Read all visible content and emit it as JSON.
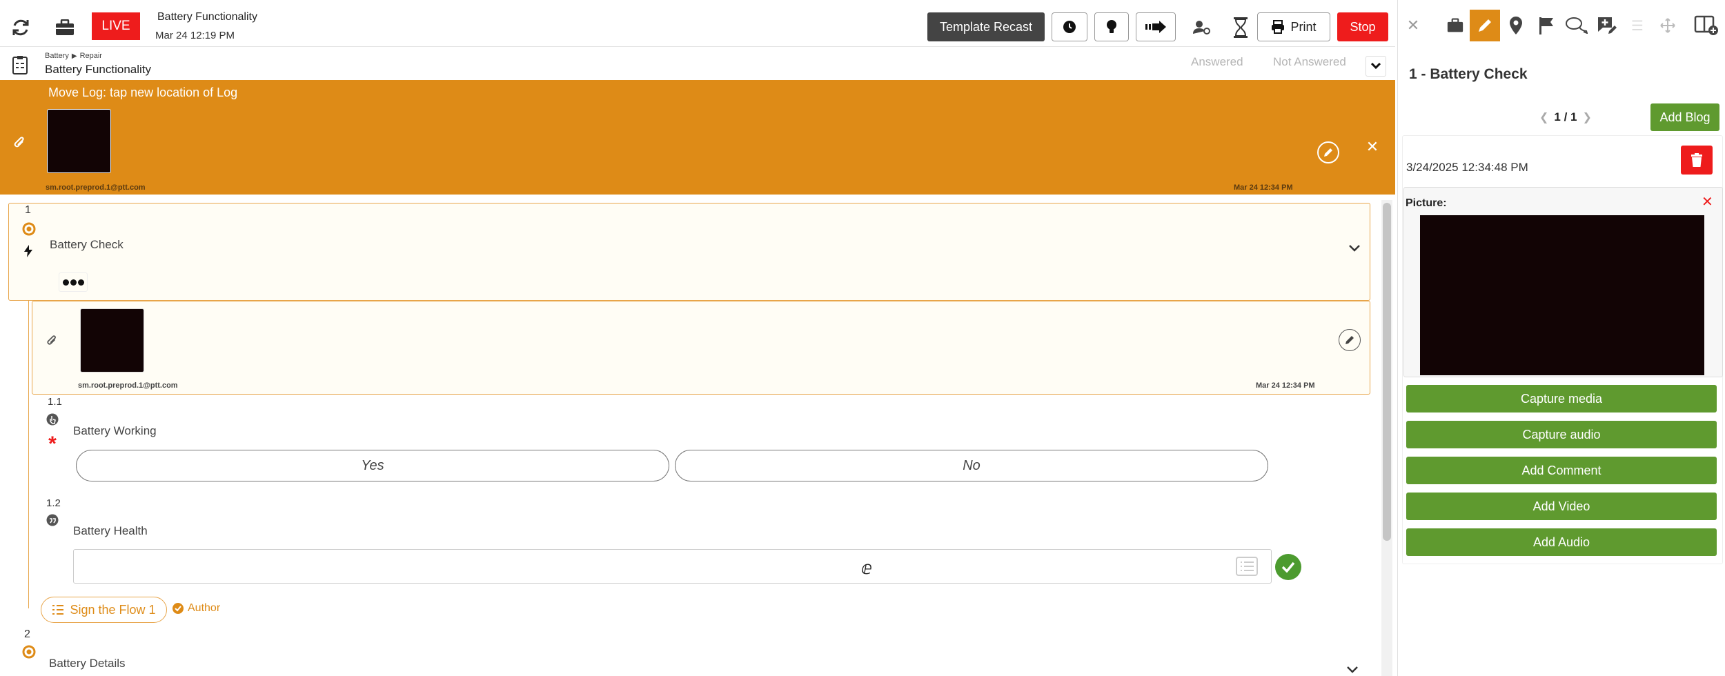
{
  "header": {
    "live_label": "LIVE",
    "title": "Battery Functionality",
    "date": "Mar 24 12:19 PM",
    "template_recast": "Template Recast",
    "print": "Print",
    "stop": "Stop"
  },
  "subheader": {
    "breadcrumb_parent": "Battery",
    "breadcrumb_child": "Repair",
    "title": "Battery Functionality",
    "tab_answered": "Answered",
    "tab_not_answered": "Not Answered"
  },
  "banner": {
    "message": "Move Log: tap new location of Log",
    "user": "sm.root.preprod.1@ptt.com",
    "timestamp": "Mar 24 12:34 PM"
  },
  "steps": {
    "step1_number": "1",
    "step1_title": "Battery Check",
    "attachment_user": "sm.root.preprod.1@ptt.com",
    "attachment_timestamp": "Mar 24 12:34 PM",
    "q11_number": "1.1",
    "q11_label": "Battery Working",
    "q11_yes": "Yes",
    "q11_no": "No",
    "q12_number": "1.2",
    "q12_label": "Battery Health",
    "sign_label": "Sign the Flow 1",
    "author_label": "Author",
    "step2_number": "2",
    "step2_title": "Battery Details"
  },
  "panel": {
    "title": "1 - Battery Check",
    "pager": "1 / 1",
    "add_blog": "Add Blog",
    "blog_date": "3/24/2025 12:34:48 PM",
    "picture_label": "Picture:",
    "actions": [
      "Capture media",
      "Capture audio",
      "Add Comment",
      "Add Video",
      "Add Audio"
    ]
  },
  "colors": {
    "accent_orange": "#de8b17",
    "live_red": "#ee1c1c",
    "action_green": "#5f9a2f"
  }
}
